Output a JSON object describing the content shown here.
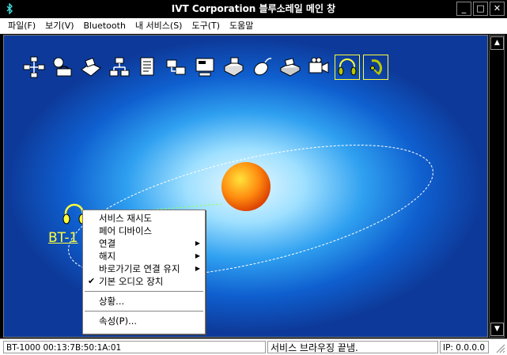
{
  "titlebar": {
    "title": "IVT Corporation 블루소레일 메인 창",
    "icon": "bluetooth-icon",
    "minimize": "_",
    "maximize": "□",
    "close": "✕"
  },
  "menubar": {
    "items": [
      "파일(F)",
      "보기(V)",
      "Bluetooth",
      "내 서비스(S)",
      "도구(T)",
      "도움말"
    ]
  },
  "services": [
    {
      "icon": "network-icon"
    },
    {
      "icon": "dialup-icon"
    },
    {
      "icon": "fax-icon"
    },
    {
      "icon": "lan-icon"
    },
    {
      "icon": "file-transfer-icon"
    },
    {
      "icon": "pan-icon"
    },
    {
      "icon": "serial-port-icon"
    },
    {
      "icon": "printer-icon"
    },
    {
      "icon": "mouse-icon"
    },
    {
      "icon": "scanner-icon"
    },
    {
      "icon": "av-icon"
    },
    {
      "icon": "headphones-icon",
      "active": true
    },
    {
      "icon": "headset-icon",
      "active": true
    }
  ],
  "device": {
    "label": "BT-1",
    "icon": "headphones-icon"
  },
  "context_menu": {
    "items": [
      {
        "label": "서비스 재시도"
      },
      {
        "label": "페어 디바이스"
      },
      {
        "label": "연결",
        "submenu": true
      },
      {
        "label": "해지",
        "submenu": true
      },
      {
        "label": "바로가기로 연결 유지",
        "submenu": true
      },
      {
        "label": "기본 오디오 장치",
        "checked": true
      },
      {
        "separator": true
      },
      {
        "label": "상황..."
      },
      {
        "separator": true
      },
      {
        "label": "속성(P)..."
      }
    ],
    "arrow_glyph": "▶",
    "check_glyph": "✔"
  },
  "statusbar": {
    "device_info": "BT-1000  00:13:7B:50:1A:01",
    "message": "서비스 브라우징 끝냄.",
    "ip": "IP: 0.0.0.0"
  },
  "colors": {
    "background_outer": "#0d3a9a",
    "glow_inner": "#e6f6ff",
    "sun_core": "#ffde33",
    "sun_edge": "#e43d00",
    "highlight": "#ffff3a"
  }
}
